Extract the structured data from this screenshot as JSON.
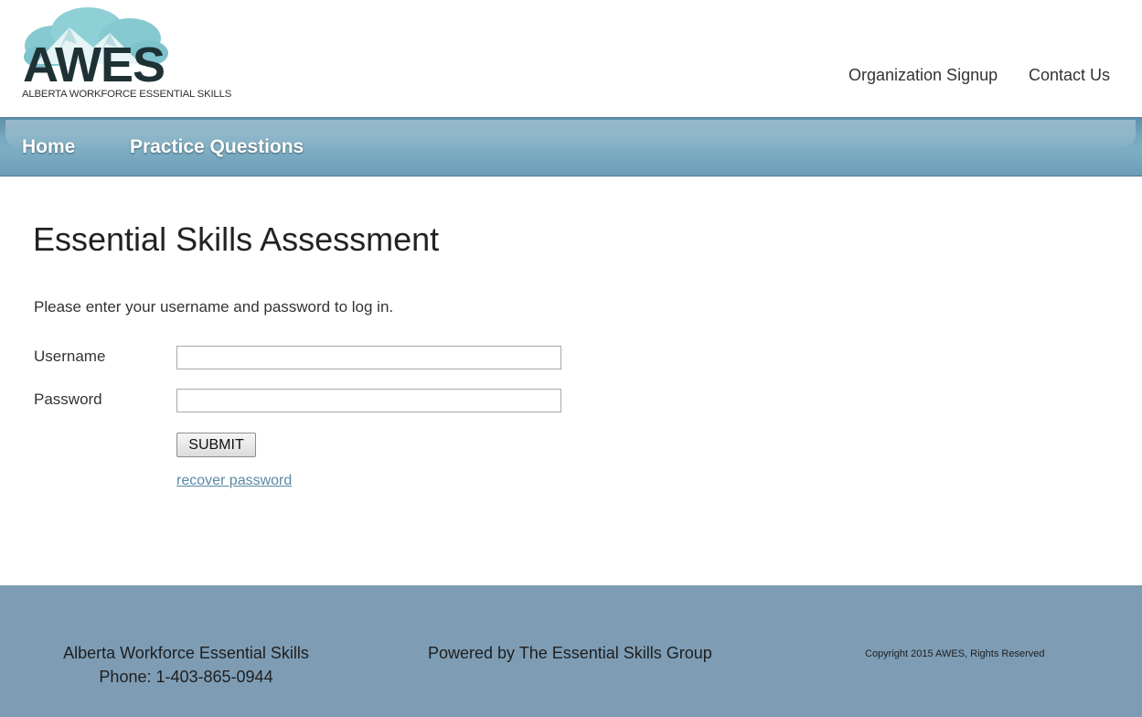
{
  "header": {
    "logo": {
      "wordmark": "AWES",
      "tagline": "ALBERTA WORKFORCE ESSENTIAL SKILLS"
    },
    "links": [
      "Organization Signup",
      "Contact Us"
    ]
  },
  "nav": {
    "items": [
      "Home",
      "Practice Questions"
    ]
  },
  "main": {
    "title": "Essential Skills Assessment",
    "intro": "Please enter your username and password to log in.",
    "username_label": "Username",
    "username_value": "",
    "password_label": "Password",
    "password_value": "",
    "submit_label": "SUBMIT",
    "recover_label": "recover password"
  },
  "footer": {
    "org_name": "Alberta Workforce Essential Skills",
    "phone": "Phone: 1-403-865-0944",
    "powered_by": "Powered by The Essential Skills Group",
    "copyright": "Copyright 2015 AWES, Rights Reserved"
  },
  "colors": {
    "nav_bar": "#6b9db5",
    "footer": "#7e9db5",
    "link": "#5a88a6",
    "logo_dark": "#1e3236",
    "logo_cloud": "#7fc6cf"
  }
}
